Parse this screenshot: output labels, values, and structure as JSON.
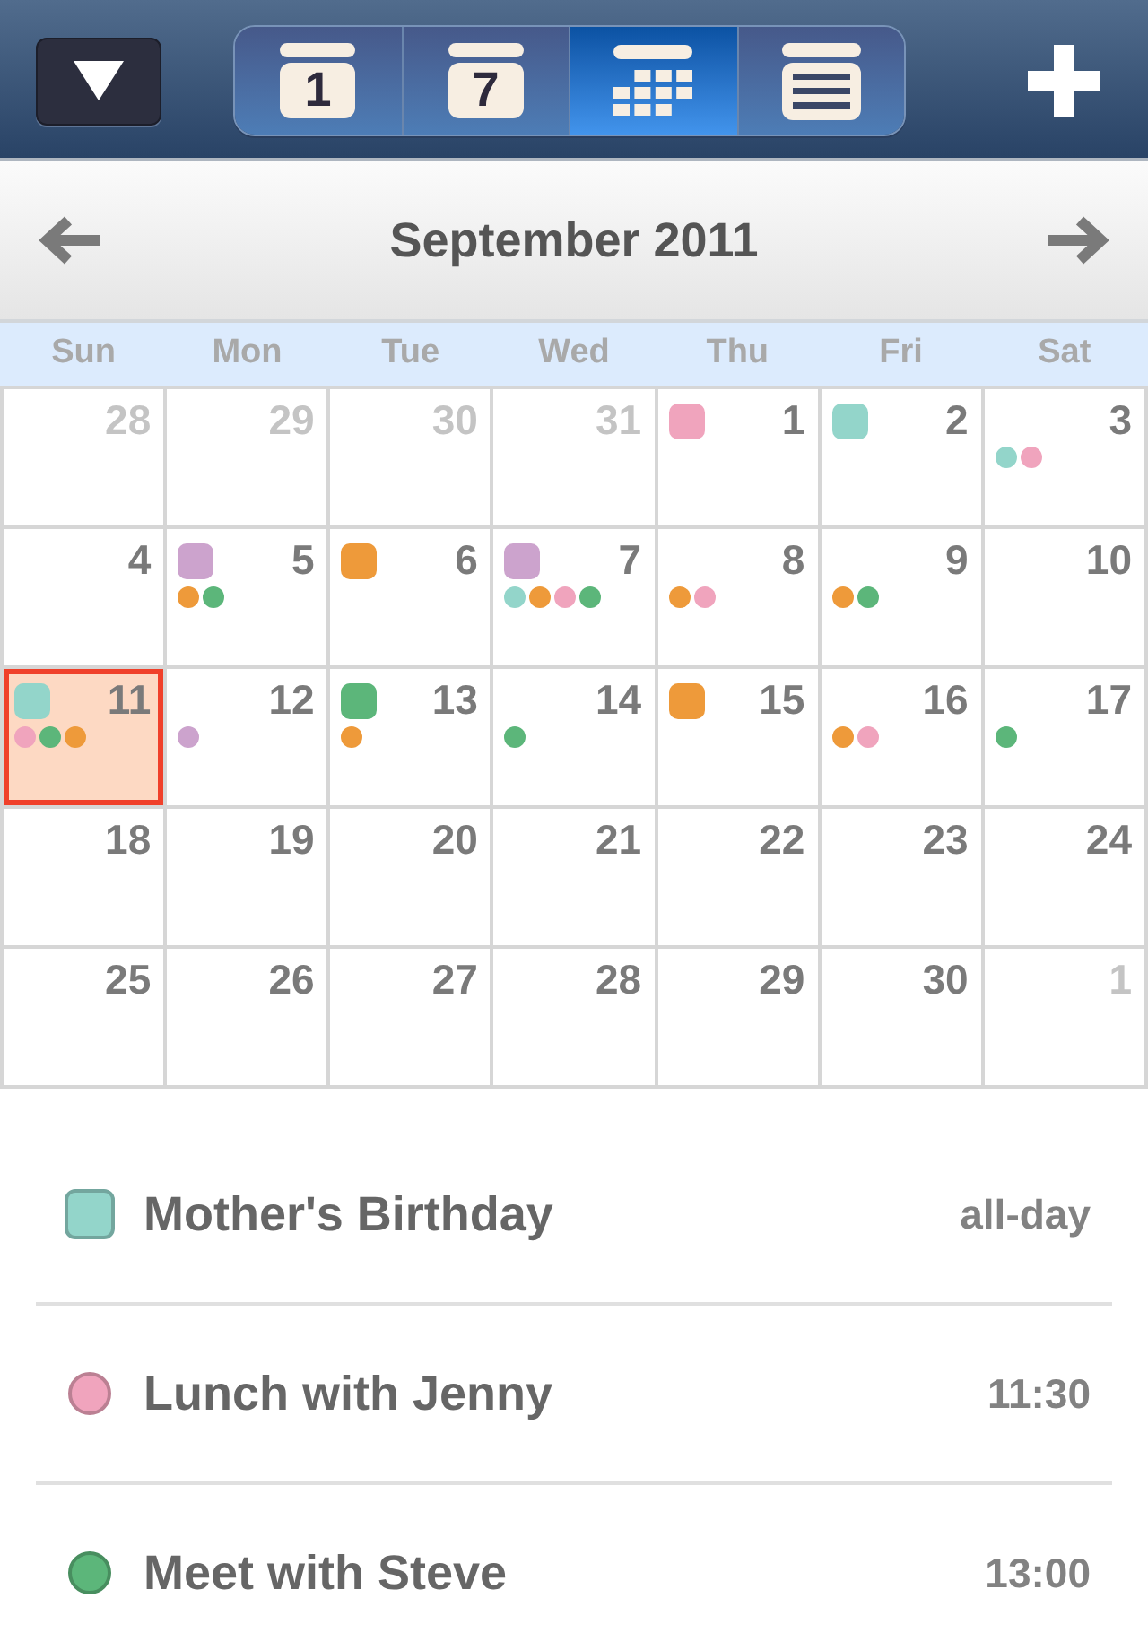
{
  "toolbar": {
    "view_tabs": [
      {
        "kind": "day",
        "label": "1",
        "selected": false
      },
      {
        "kind": "week",
        "label": "7",
        "selected": false
      },
      {
        "kind": "month",
        "selected": true
      },
      {
        "kind": "list",
        "selected": false
      }
    ]
  },
  "month_header": {
    "title": "September 2011"
  },
  "weekdays": [
    "Sun",
    "Mon",
    "Tue",
    "Wed",
    "Thu",
    "Fri",
    "Sat"
  ],
  "weeks": [
    [
      {
        "day": "28",
        "in_month": false,
        "selected": false
      },
      {
        "day": "29",
        "in_month": false,
        "selected": false
      },
      {
        "day": "30",
        "in_month": false,
        "selected": false
      },
      {
        "day": "31",
        "in_month": false,
        "selected": false
      },
      {
        "day": "1",
        "in_month": true,
        "selected": false,
        "all_day_events": [
          {
            "color": "#f0a4bd"
          }
        ]
      },
      {
        "day": "2",
        "in_month": true,
        "selected": false,
        "all_day_events": [
          {
            "color": "#93d5ca"
          }
        ]
      },
      {
        "day": "3",
        "in_month": true,
        "selected": false,
        "timed_events": [
          {
            "color": "#93d5ca"
          },
          {
            "color": "#f0a4bd"
          }
        ]
      }
    ],
    [
      {
        "day": "4",
        "in_month": true,
        "selected": false
      },
      {
        "day": "5",
        "in_month": true,
        "selected": false,
        "all_day_events": [
          {
            "color": "#cca3cd"
          }
        ],
        "timed_events": [
          {
            "color": "#ee9a3a"
          },
          {
            "color": "#5cb67a"
          }
        ]
      },
      {
        "day": "6",
        "in_month": true,
        "selected": false,
        "all_day_events": [
          {
            "color": "#ee9a3a"
          }
        ]
      },
      {
        "day": "7",
        "in_month": true,
        "selected": false,
        "all_day_events": [
          {
            "color": "#cca3cd"
          }
        ],
        "timed_events": [
          {
            "color": "#93d5ca"
          },
          {
            "color": "#ee9a3a"
          },
          {
            "color": "#f0a4bd"
          },
          {
            "color": "#5cb67a"
          }
        ]
      },
      {
        "day": "8",
        "in_month": true,
        "selected": false,
        "timed_events": [
          {
            "color": "#ee9a3a"
          },
          {
            "color": "#f0a4bd"
          }
        ]
      },
      {
        "day": "9",
        "in_month": true,
        "selected": false,
        "timed_events": [
          {
            "color": "#ee9a3a"
          },
          {
            "color": "#5cb67a"
          }
        ]
      },
      {
        "day": "10",
        "in_month": true,
        "selected": false
      }
    ],
    [
      {
        "day": "11",
        "in_month": true,
        "selected": true,
        "all_day_events": [
          {
            "color": "#93d5ca"
          }
        ],
        "timed_events": [
          {
            "color": "#f0a4bd"
          },
          {
            "color": "#5cb67a"
          },
          {
            "color": "#ee9a3a"
          }
        ]
      },
      {
        "day": "12",
        "in_month": true,
        "selected": false,
        "timed_events": [
          {
            "color": "#cca3cd"
          }
        ]
      },
      {
        "day": "13",
        "in_month": true,
        "selected": false,
        "all_day_events": [
          {
            "color": "#5cb67a"
          }
        ],
        "timed_events": [
          {
            "color": "#ee9a3a"
          }
        ]
      },
      {
        "day": "14",
        "in_month": true,
        "selected": false,
        "timed_events": [
          {
            "color": "#5cb67a"
          }
        ]
      },
      {
        "day": "15",
        "in_month": true,
        "selected": false,
        "all_day_events": [
          {
            "color": "#ee9a3a"
          }
        ]
      },
      {
        "day": "16",
        "in_month": true,
        "selected": false,
        "timed_events": [
          {
            "color": "#ee9a3a"
          },
          {
            "color": "#f0a4bd"
          }
        ]
      },
      {
        "day": "17",
        "in_month": true,
        "selected": false,
        "timed_events": [
          {
            "color": "#5cb67a"
          }
        ]
      }
    ],
    [
      {
        "day": "18",
        "in_month": true,
        "selected": false
      },
      {
        "day": "19",
        "in_month": true,
        "selected": false
      },
      {
        "day": "20",
        "in_month": true,
        "selected": false
      },
      {
        "day": "21",
        "in_month": true,
        "selected": false
      },
      {
        "day": "22",
        "in_month": true,
        "selected": false
      },
      {
        "day": "23",
        "in_month": true,
        "selected": false
      },
      {
        "day": "24",
        "in_month": true,
        "selected": false
      }
    ],
    [
      {
        "day": "25",
        "in_month": true,
        "selected": false
      },
      {
        "day": "26",
        "in_month": true,
        "selected": false
      },
      {
        "day": "27",
        "in_month": true,
        "selected": false
      },
      {
        "day": "28",
        "in_month": true,
        "selected": false
      },
      {
        "day": "29",
        "in_month": true,
        "selected": false
      },
      {
        "day": "30",
        "in_month": true,
        "selected": false
      },
      {
        "day": "1",
        "in_month": false,
        "selected": false
      }
    ]
  ],
  "events": [
    {
      "kind": "all_day",
      "title": "Mother's Birthday",
      "time": "all-day",
      "color": "#93d5ca"
    },
    {
      "kind": "timed",
      "title": "Lunch with Jenny",
      "time": "11:30",
      "color": "#f0a4bd"
    },
    {
      "kind": "timed",
      "title": "Meet with Steve",
      "time": "13:00",
      "color": "#5cb67a"
    }
  ]
}
